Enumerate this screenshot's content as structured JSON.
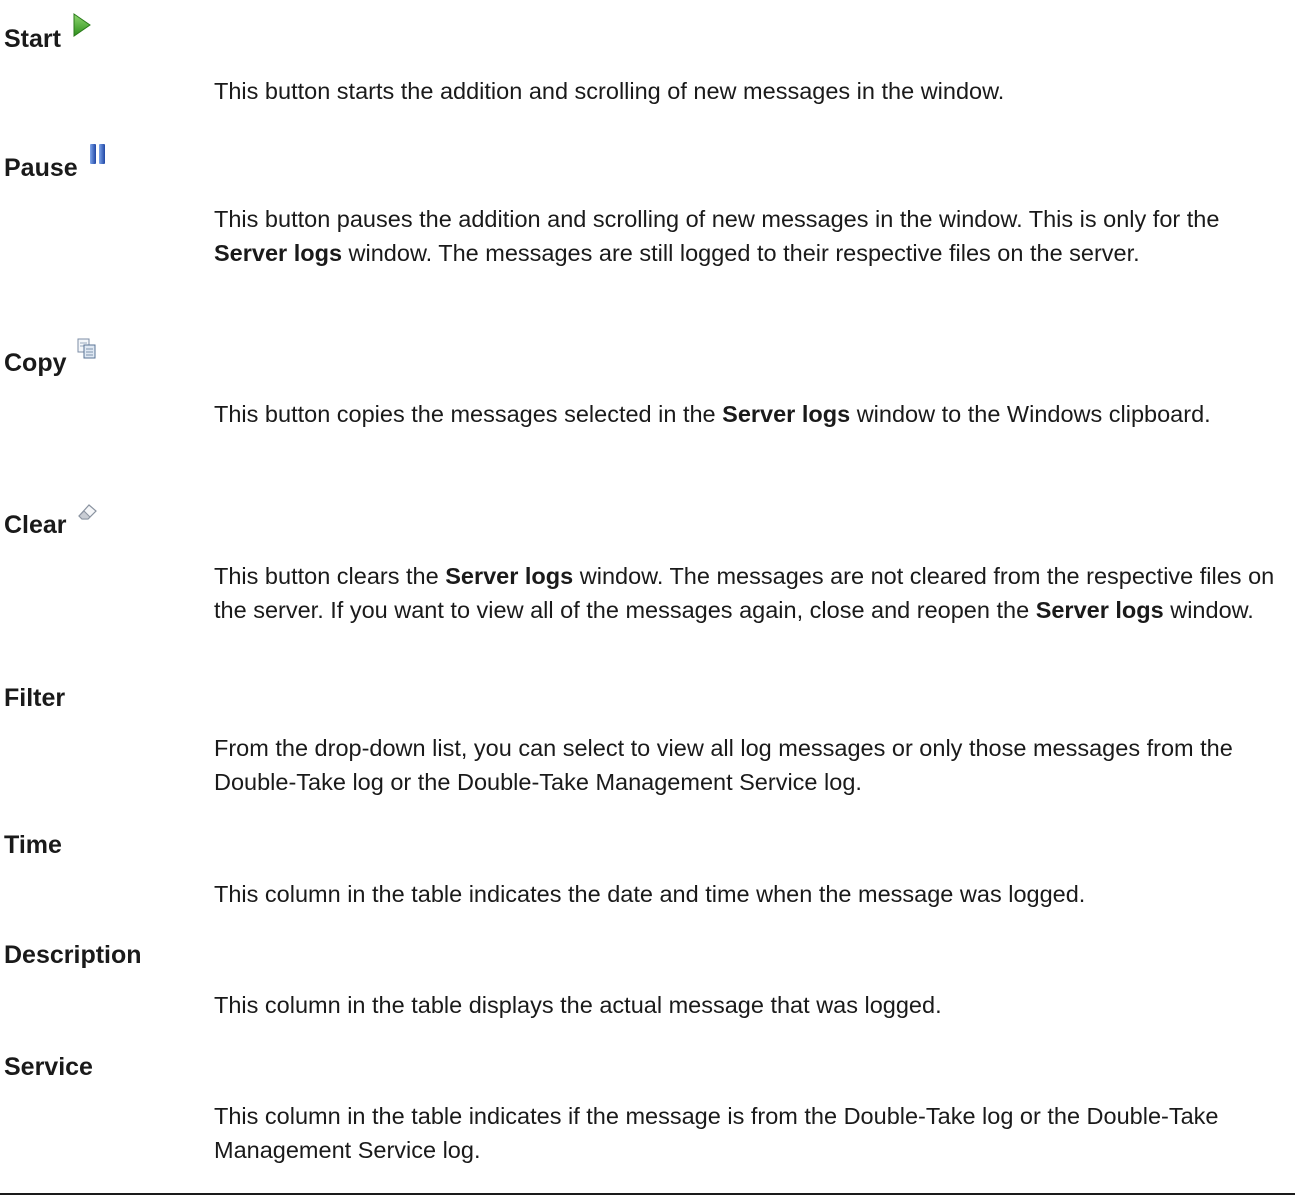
{
  "entries": [
    {
      "title": "Start",
      "icon": "play-icon",
      "body": [
        "This button starts the addition and scrolling of new messages in the window."
      ]
    },
    {
      "title": "Pause",
      "icon": "pause-icon",
      "body": [
        "This button pauses the addition and scrolling of new messages in the window. This is only for the ",
        "Server logs",
        " window. The messages are still logged to their respective files on the server."
      ]
    },
    {
      "title": "Copy",
      "icon": "copy-icon",
      "body": [
        "This button copies the messages selected in the ",
        "Server logs",
        " window to the Windows clipboard."
      ]
    },
    {
      "title": "Clear",
      "icon": "eraser-icon",
      "body": [
        "This button clears the ",
        "Server logs",
        " window. The messages are not cleared from the respective files on the server. If you want to view all of the messages again, close and reopen the ",
        "Server logs",
        " window."
      ]
    },
    {
      "title": "Filter",
      "body": [
        "From the drop-down list, you can select to view all log messages or only those messages from the Double-Take log or the Double-Take Management Service log."
      ]
    },
    {
      "title": "Time",
      "body": [
        "This column in the table indicates the date and time when the message was logged."
      ]
    },
    {
      "title": "Description",
      "body": [
        "This column in the table displays the actual message that was logged."
      ]
    },
    {
      "title": "Service",
      "body": [
        "This column in the table indicates if the message is from the Double-Take log or the Double-Take Management Service log."
      ]
    }
  ],
  "colors": {
    "text": "#1a1a1a",
    "play_icon": "#3aa32a",
    "pause_icon": "#2f5bb5"
  }
}
